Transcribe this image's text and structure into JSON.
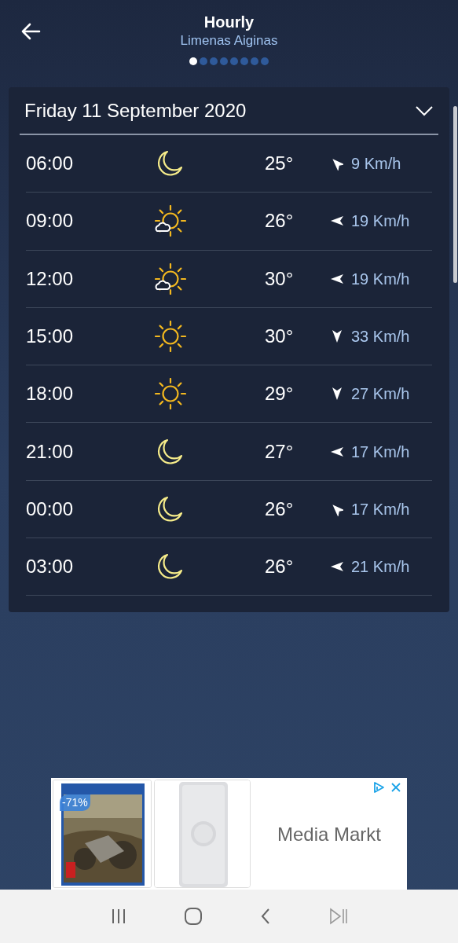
{
  "header": {
    "title": "Hourly",
    "subtitle": "Limenas Aiginas"
  },
  "pager": [
    {
      "selected": true
    },
    {
      "selected": false
    },
    {
      "selected": false
    },
    {
      "selected": false
    },
    {
      "selected": false
    },
    {
      "selected": false
    },
    {
      "selected": false
    },
    {
      "selected": false
    }
  ],
  "day": {
    "date": "Friday 11 September 2020",
    "expanded": true
  },
  "rows": [
    {
      "time": "06:00",
      "weather_icon": {
        "kind": "moon"
      },
      "temp": "25°",
      "wind_arrow": {
        "kind": "northwest"
      },
      "wind": "9 Km/h"
    },
    {
      "time": "09:00",
      "weather_icon": {
        "kind": "suncloud"
      },
      "temp": "26°",
      "wind_arrow": {
        "kind": "west"
      },
      "wind": "19 Km/h"
    },
    {
      "time": "12:00",
      "weather_icon": {
        "kind": "suncloud"
      },
      "temp": "30°",
      "wind_arrow": {
        "kind": "west"
      },
      "wind": "19 Km/h"
    },
    {
      "time": "15:00",
      "weather_icon": {
        "kind": "sun"
      },
      "temp": "30°",
      "wind_arrow": {
        "kind": "south"
      },
      "wind": "33 Km/h"
    },
    {
      "time": "18:00",
      "weather_icon": {
        "kind": "sun"
      },
      "temp": "29°",
      "wind_arrow": {
        "kind": "south"
      },
      "wind": "27 Km/h"
    },
    {
      "time": "21:00",
      "weather_icon": {
        "kind": "moon"
      },
      "temp": "27°",
      "wind_arrow": {
        "kind": "west"
      },
      "wind": "17 Km/h"
    },
    {
      "time": "00:00",
      "weather_icon": {
        "kind": "moon"
      },
      "temp": "26°",
      "wind_arrow": {
        "kind": "northwest"
      },
      "wind": "17 Km/h"
    },
    {
      "time": "03:00",
      "weather_icon": {
        "kind": "moon"
      },
      "temp": "26°",
      "wind_arrow": {
        "kind": "west"
      },
      "wind": "21 Km/h"
    }
  ],
  "ad": {
    "badge": "-71%",
    "advertiser": "Media Markt"
  }
}
